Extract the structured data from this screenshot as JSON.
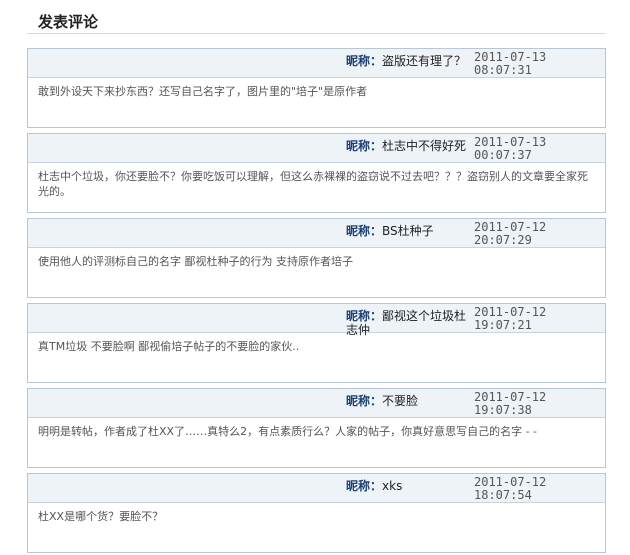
{
  "page": {
    "title": "发表评论"
  },
  "nick_label": "昵称：",
  "comments": [
    {
      "nick": "盗版还有理了？",
      "date": "2011-07-13",
      "time": "08:07:31",
      "content": "敢到外设天下来抄东西？还写自己名字了，图片里的\"培子\"是原作者"
    },
    {
      "nick": "杜志中不得好死",
      "date": "2011-07-13",
      "time": "00:07:37",
      "content": "杜志中个垃圾，你还要脸不？你要吃饭可以理解，但这么赤裸裸的盗窃说不过去吧？？？盗窃别人的文章要全家死光的。"
    },
    {
      "nick": "BS杜种子",
      "date": "2011-07-12",
      "time": "20:07:29",
      "content": "使用他人的评测标自己的名字 鄙视杜种子的行为 支持原作者培子"
    },
    {
      "nick": "鄙视这个垃圾杜志仲",
      "date": "2011-07-12",
      "time": "19:07:21",
      "content": "真TM垃圾 不要脸啊 鄙视偷培子帖子的不要脸的家伙.."
    },
    {
      "nick": "不要脸",
      "date": "2011-07-12",
      "time": "19:07:38",
      "content": "明明是转帖，作者成了杜XX了……真特么2，有点素质行么？人家的帖子，你真好意思写自己的名字 - -"
    },
    {
      "nick": "xks",
      "date": "2011-07-12",
      "time": "18:07:54",
      "content": "杜XX是哪个货？要脸不？"
    }
  ]
}
